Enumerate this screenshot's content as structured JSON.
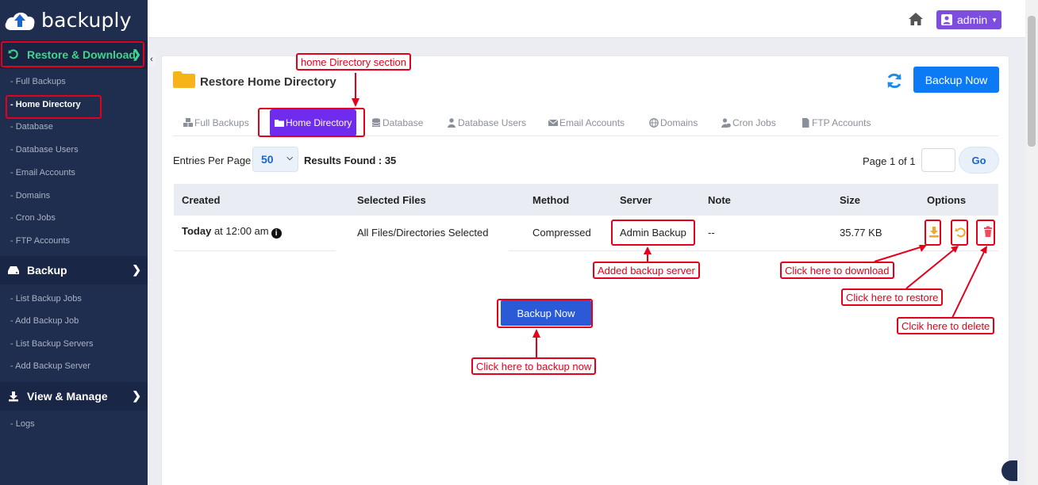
{
  "app": {
    "logo_text": "backuply"
  },
  "sidebar": {
    "restore_section": "Restore & Download",
    "restore_items": [
      {
        "label": "- Full Backups"
      },
      {
        "label": "- Home Directory"
      },
      {
        "label": "- Database"
      },
      {
        "label": "- Database Users"
      },
      {
        "label": "- Email Accounts"
      },
      {
        "label": "- Domains"
      },
      {
        "label": "- Cron Jobs"
      },
      {
        "label": "- FTP Accounts"
      }
    ],
    "backup_section": "Backup",
    "backup_items": [
      {
        "label": "- List Backup Jobs"
      },
      {
        "label": "- Add Backup Job"
      },
      {
        "label": "- List Backup Servers"
      },
      {
        "label": "- Add Backup Server"
      }
    ],
    "view_section": "View & Manage",
    "view_items": [
      {
        "label": "- Logs"
      }
    ]
  },
  "topbar": {
    "user": "admin"
  },
  "page": {
    "title": "Restore Home Directory",
    "backup_now_top": "Backup Now",
    "tabs": [
      {
        "label": "Full Backups"
      },
      {
        "label": "Home Directory"
      },
      {
        "label": "Database"
      },
      {
        "label": "Database Users"
      },
      {
        "label": "Email Accounts"
      },
      {
        "label": "Domains"
      },
      {
        "label": "Cron Jobs"
      },
      {
        "label": "FTP Accounts"
      }
    ],
    "entries_label": "Entries Per Page",
    "entries_value": "50",
    "results_label": "Results Found : 35",
    "page_info": "Page 1 of 1",
    "go_label": "Go",
    "columns": [
      "Created",
      "Selected Files",
      "Method",
      "Server",
      "Note",
      "Size",
      "Options"
    ],
    "rows": [
      {
        "created_bold": "Today",
        "created_rest": " at 12:00 am",
        "files": "All Files/Directories Selected",
        "method": "Compressed",
        "server": "Admin Backup",
        "note": "--",
        "size": "35.77 KB"
      }
    ],
    "backup_now_center": "Backup Now"
  },
  "annotations": {
    "home_dir_section": "home Directory section",
    "added_server": "Added backup server",
    "download": "Click here to download",
    "restore": "Click here to restore",
    "delete": "Clcik here to delete",
    "backup_now": "Click here to backup now"
  },
  "colors": {
    "sidebar_bg": "#1f2d4e",
    "active_green": "#3dd68c",
    "primary_blue": "#0d7af5",
    "active_tab_purple": "#6f2bee",
    "annotation_red": "#e3001b",
    "download_orange": "#f6a623",
    "delete_red": "#ef4b5a"
  }
}
